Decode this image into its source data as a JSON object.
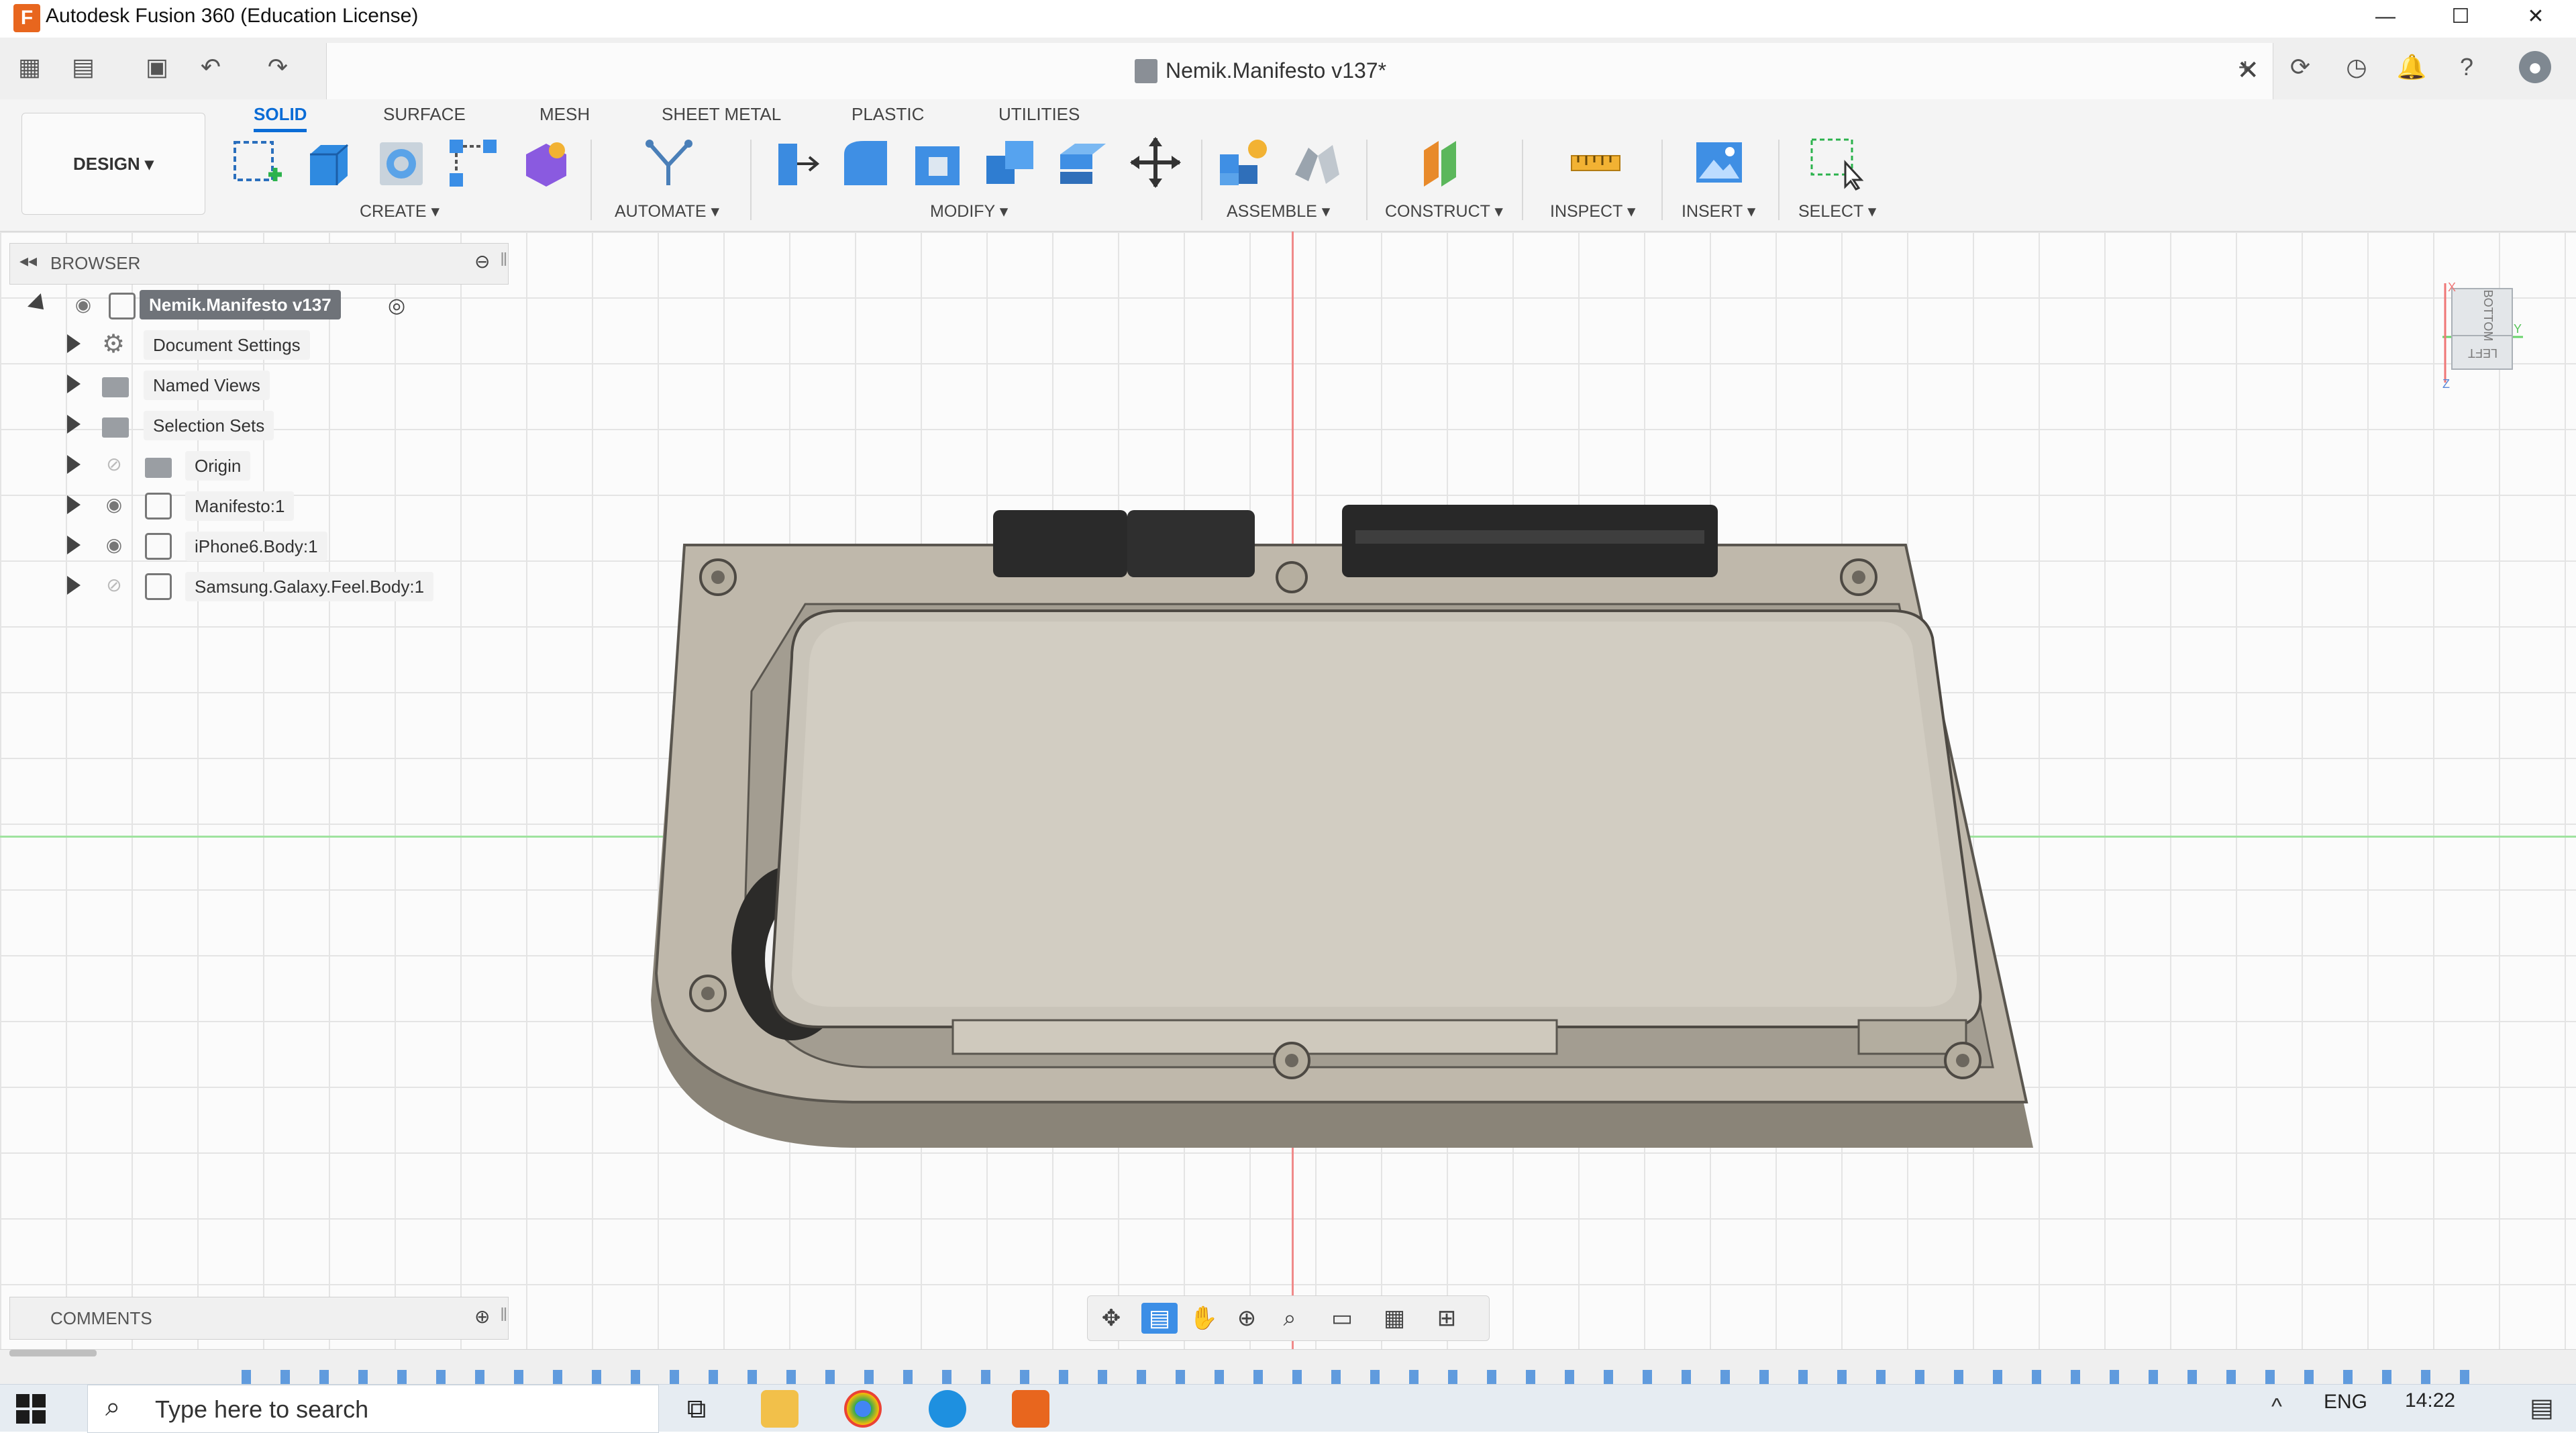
{
  "app": {
    "title": "Autodesk Fusion 360 (Education License)",
    "logo_letter": "F"
  },
  "window_controls": {
    "minimize": "—",
    "maximize": "☐",
    "close": "✕"
  },
  "document": {
    "name": "Nemik.Manifesto v137*",
    "close": "✕"
  },
  "toolbar": {
    "workspace": "DESIGN",
    "tabs": [
      "SOLID",
      "SURFACE",
      "MESH",
      "SHEET METAL",
      "PLASTIC",
      "UTILITIES"
    ],
    "active_tab": "SOLID",
    "groups": [
      "CREATE",
      "AUTOMATE",
      "MODIFY",
      "ASSEMBLE",
      "CONSTRUCT",
      "INSPECT",
      "INSERT",
      "SELECT"
    ]
  },
  "browser": {
    "title": "BROWSER",
    "root": "Nemik.Manifesto v137",
    "items": [
      {
        "label": "Document Settings",
        "icon": "gear-icon"
      },
      {
        "label": "Named Views",
        "icon": "folder-icon"
      },
      {
        "label": "Selection Sets",
        "icon": "folder-icon"
      },
      {
        "label": "Origin",
        "icon": "folder-icon",
        "hidden": true
      },
      {
        "label": "Manifesto:1",
        "icon": "component-icon"
      },
      {
        "label": "iPhone6.Body:1",
        "icon": "body-icon"
      },
      {
        "label": "Samsung.Galaxy.Feel.Body:1",
        "icon": "body-icon",
        "hidden": true
      }
    ]
  },
  "comments": {
    "title": "COMMENTS"
  },
  "viewcube": {
    "face_top": "BOTTOM",
    "face_side": "LEFT",
    "axis_x": "X",
    "axis_y": "Y",
    "axis_z": "Z"
  },
  "taskbar": {
    "search_placeholder": "Type here to search",
    "language": "ENG",
    "time": "14:22"
  },
  "colors": {
    "accent": "#0a6cd6",
    "model_body": "#bfb8ab",
    "model_tray": "#d2cdc2",
    "grid": "#e4e4e4"
  }
}
